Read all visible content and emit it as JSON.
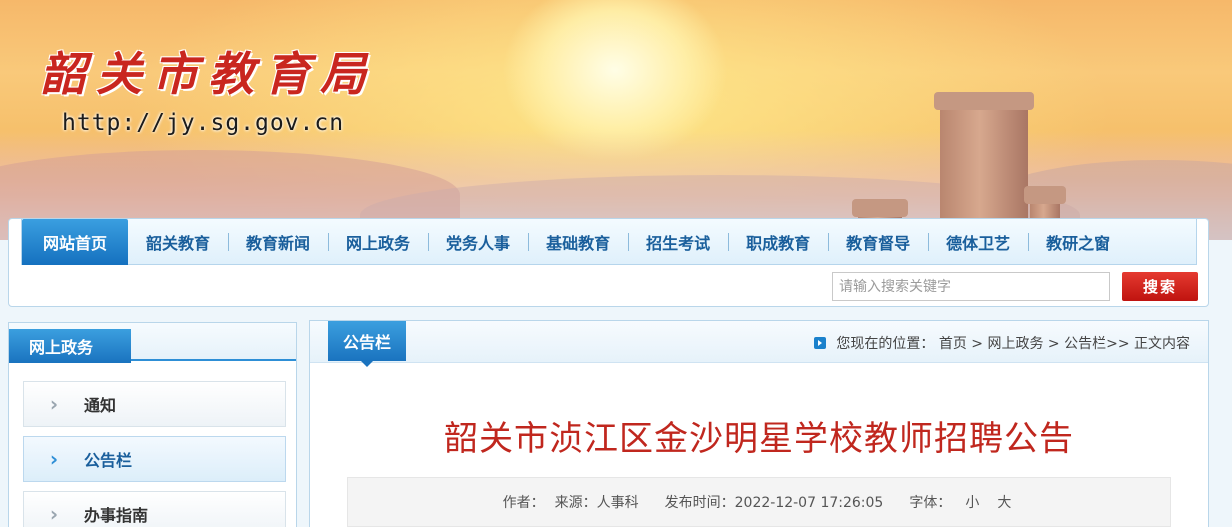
{
  "header": {
    "site_title": "韶关市教育局",
    "site_url": "http://jy.sg.gov.cn"
  },
  "nav": {
    "items": [
      {
        "label": "网站首页",
        "active": true
      },
      {
        "label": "韶关教育"
      },
      {
        "label": "教育新闻"
      },
      {
        "label": "网上政务"
      },
      {
        "label": "党务人事"
      },
      {
        "label": "基础教育"
      },
      {
        "label": "招生考试"
      },
      {
        "label": "职成教育"
      },
      {
        "label": "教育督导"
      },
      {
        "label": "德体卫艺"
      },
      {
        "label": "教研之窗"
      }
    ]
  },
  "search": {
    "placeholder": "请输入搜索关键字",
    "button_label": "搜索"
  },
  "sidebar": {
    "title": "网上政务",
    "items": [
      {
        "label": "通知"
      },
      {
        "label": "公告栏",
        "active": true
      },
      {
        "label": "办事指南"
      }
    ]
  },
  "main": {
    "tab_label": "公告栏",
    "location": "您现在的位置：   首页 > 网上政务 > 公告栏>> 正文内容",
    "article_title": "韶关市浈江区金沙明星学校教师招聘公告",
    "meta": {
      "author": "作者：",
      "source": "来源：人事科",
      "published": "发布时间：2022-12-07 17:26:05",
      "font_label": "字体：",
      "font_small": "小",
      "font_large": "大"
    }
  },
  "colors": {
    "brand_blue": "#1a73bf",
    "title_red": "#c0271e",
    "search_red": "#bf130f"
  }
}
